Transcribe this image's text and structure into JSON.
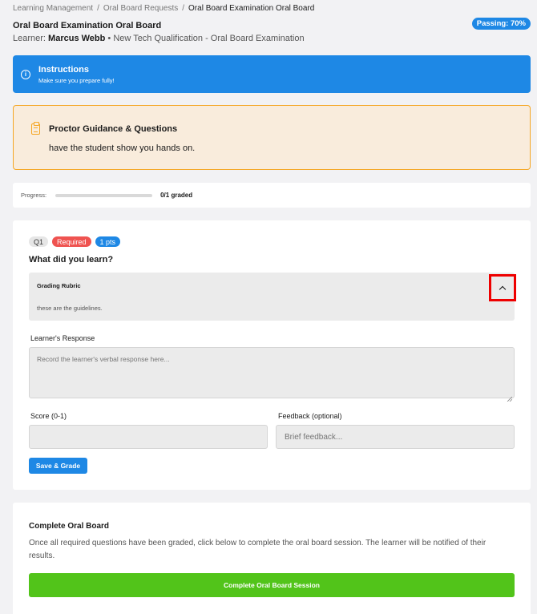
{
  "breadcrumb": {
    "items": [
      "Learning Management",
      "Oral Board Requests",
      "Oral Board Examination Oral Board"
    ],
    "separator": "/"
  },
  "header": {
    "title": "Oral Board Examination Oral Board",
    "learner_prefix": "Learner:",
    "learner_name": "Marcus Webb",
    "learner_suffix": "• New Tech Qualification - Oral Board Examination",
    "passing_badge": "Passing: 70%"
  },
  "instructions": {
    "title": "Instructions",
    "text": "Make sure you prepare fully!",
    "icon": "info-icon"
  },
  "proctor": {
    "title": "Proctor Guidance & Questions",
    "text": "have the student show you hands on.",
    "icon": "clipboard-icon"
  },
  "progress": {
    "label": "Progress:",
    "text": "0/1 graded",
    "fraction": 0
  },
  "question": {
    "number_tag": "Q1",
    "required_tag": "Required",
    "points_tag": "1 pts",
    "title": "What did you learn?",
    "rubric_title": "Grading Rubric",
    "rubric_text": "these are the guidelines.",
    "rubric_toggle_icon": "chevron-up-icon",
    "response_label": "Learner's Response",
    "response_placeholder": "Record the learner's verbal response here...",
    "score_label": "Score (0-1)",
    "score_value": "",
    "feedback_label": "Feedback (optional)",
    "feedback_placeholder": "Brief feedback...",
    "save_button": "Save & Grade"
  },
  "complete": {
    "title": "Complete Oral Board",
    "text": "Once all required questions have been graded, click below to complete the oral board session. The learner will be notified of their results.",
    "button": "Complete Oral Board Session"
  },
  "colors": {
    "primary": "#1e88e5",
    "warning_border": "#f5a623",
    "warning_bg": "#f9ecdc",
    "danger": "#ef5350",
    "success": "#52c41a",
    "highlight": "#e00000"
  }
}
